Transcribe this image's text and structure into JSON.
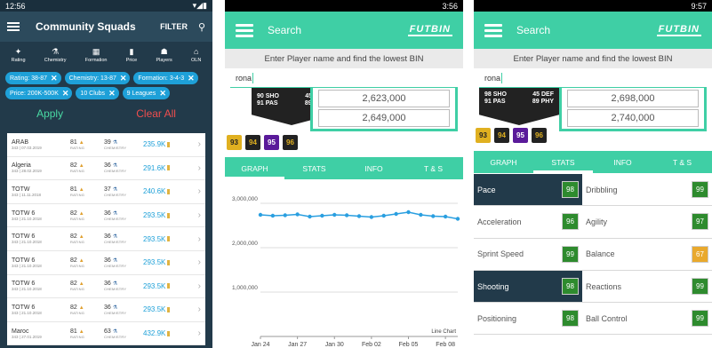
{
  "p1": {
    "status_time": "12:56",
    "title": "Community Squads",
    "filter_label": "FILTER",
    "categories": [
      "Rating",
      "Chemistry",
      "Formation",
      "Price",
      "Players",
      "OLN"
    ],
    "chips": [
      "Rating: 38-87",
      "Chemistry: 13-87",
      "Formation: 3-4-3",
      "Price: 200K-500K",
      "10 Clubs",
      "9 Leagues"
    ],
    "apply_label": "Apply",
    "clear_label": "Clear All",
    "rating_sub": "RATING",
    "chem_sub": "CHEMISTRY",
    "rows": [
      {
        "name": "ARAB",
        "sub": "343 | 07.03.2019",
        "rating": "81",
        "chem": "39",
        "price": "235.9K"
      },
      {
        "name": "Algeria",
        "sub": "343 | 28.02.2019",
        "rating": "82",
        "chem": "36",
        "price": "291.6K"
      },
      {
        "name": "TOTW",
        "sub": "343 | 11.11.2018",
        "rating": "81",
        "chem": "37",
        "price": "240.6K"
      },
      {
        "name": "TOTW 6",
        "sub": "343 | 21.10.2018",
        "rating": "82",
        "chem": "36",
        "price": "293.5K"
      },
      {
        "name": "TOTW 6",
        "sub": "343 | 21.10.2018",
        "rating": "82",
        "chem": "36",
        "price": "293.5K"
      },
      {
        "name": "TOTW 6",
        "sub": "343 | 21.10.2018",
        "rating": "82",
        "chem": "36",
        "price": "293.5K"
      },
      {
        "name": "TOTW 6",
        "sub": "343 | 21.10.2018",
        "rating": "82",
        "chem": "36",
        "price": "293.5K"
      },
      {
        "name": "TOTW 6",
        "sub": "343 | 21.10.2018",
        "rating": "82",
        "chem": "36",
        "price": "293.5K"
      },
      {
        "name": "Maroc",
        "sub": "343 | 27.01.2019",
        "rating": "81",
        "chem": "63",
        "price": "432.9K"
      }
    ]
  },
  "p2": {
    "status_time": "3:56",
    "search_label": "Search",
    "logo": "FUTBIN",
    "hint": "Enter Player name and find the lowest BIN",
    "query": "rona",
    "card_stats": [
      [
        "90 SHO",
        "45 DEF"
      ],
      [
        "91 PAS",
        "89 PHY"
      ]
    ],
    "prices": [
      "2,623,000",
      "2,649,000"
    ],
    "badges": [
      "93",
      "94",
      "95",
      "96"
    ],
    "tabs": [
      "GRAPH",
      "STATS",
      "INFO",
      "T & S"
    ],
    "chart_corner_label": "Line Chart"
  },
  "p3": {
    "status_time": "9:57",
    "search_label": "Search",
    "logo": "FUTBIN",
    "hint": "Enter Player name and find the lowest BIN",
    "query": "rona",
    "card_stats": [
      [
        "98 SHO",
        "45 DEF"
      ],
      [
        "91 PAS",
        "89 PHY"
      ]
    ],
    "prices": [
      "2,698,000",
      "2,740,000"
    ],
    "badges": [
      "93",
      "94",
      "95",
      "96"
    ],
    "tabs": [
      "GRAPH",
      "STATS",
      "INFO",
      "T & S"
    ],
    "stats": [
      {
        "l": "Pace",
        "lv": "98",
        "r": "Dribbling",
        "rv": "99",
        "ld": true
      },
      {
        "l": "Acceleration",
        "lv": "96",
        "r": "Agility",
        "rv": "97",
        "ld": false
      },
      {
        "l": "Sprint Speed",
        "lv": "99",
        "r": "Balance",
        "rv": "67",
        "ld": false,
        "ry": true
      },
      {
        "l": "Shooting",
        "lv": "98",
        "r": "Reactions",
        "rv": "99",
        "ld": true
      },
      {
        "l": "Positioning",
        "lv": "98",
        "r": "Ball Control",
        "rv": "99",
        "ld": false
      }
    ]
  },
  "chart_data": {
    "type": "line",
    "x": [
      "Jan 24",
      "Jan 25",
      "Jan 26",
      "Jan 27",
      "Jan 28",
      "Jan 29",
      "Jan 30",
      "Jan 31",
      "Feb 01",
      "Feb 02",
      "Feb 03",
      "Feb 04",
      "Feb 05",
      "Feb 06",
      "Feb 07",
      "Feb 08",
      "Feb 09"
    ],
    "xticks": [
      "Jan 24",
      "Jan 27",
      "Jan 30",
      "Feb 02",
      "Feb 05",
      "Feb 08"
    ],
    "values": [
      2740000,
      2720000,
      2730000,
      2750000,
      2700000,
      2720000,
      2740000,
      2730000,
      2710000,
      2690000,
      2720000,
      2760000,
      2800000,
      2740000,
      2710000,
      2700000,
      2650000
    ],
    "yticks": [
      "3,000,000",
      "2,000,000",
      "1,000,000"
    ],
    "ylim": [
      0,
      3000000
    ],
    "color": "#2a9fe0"
  }
}
